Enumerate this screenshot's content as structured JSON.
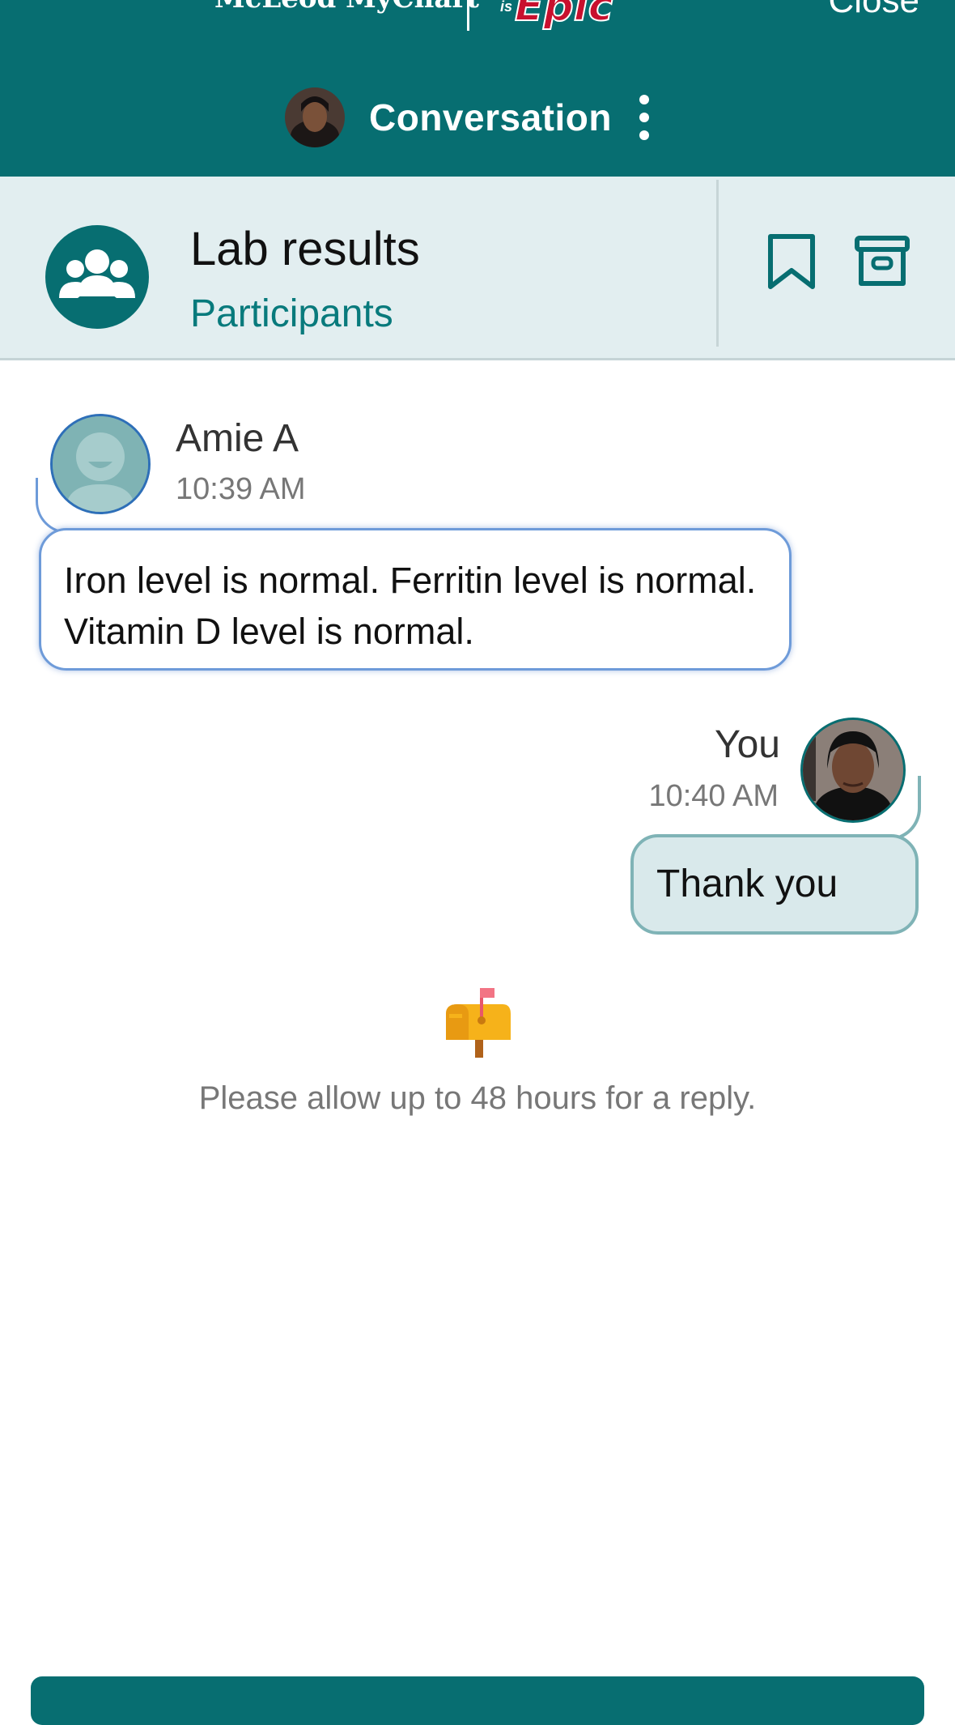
{
  "app": {
    "brand_text": "McLeod MyChart",
    "epic_prefix": "is",
    "epic_logo": "Epic",
    "close_label": "Close",
    "header_title": "Conversation"
  },
  "thread": {
    "title": "Lab results",
    "participants_label": "Participants"
  },
  "messages": [
    {
      "sender": "Amie A",
      "time": "10:39 AM",
      "text": "Iron level is normal. Ferritin level is normal. Vitamin D level is normal."
    },
    {
      "sender": "You",
      "time": "10:40 AM",
      "text": "Thank you"
    }
  ],
  "notice": {
    "text": "Please allow up to 48 hours for a reply.",
    "icon": "mailbox-icon"
  },
  "colors": {
    "brand_teal": "#076e71",
    "subheader_bg": "#e2eef0",
    "outgoing_bubble": "#d9e9eb",
    "incoming_border": "#6e9bd9",
    "epic_red": "#c8102e"
  }
}
